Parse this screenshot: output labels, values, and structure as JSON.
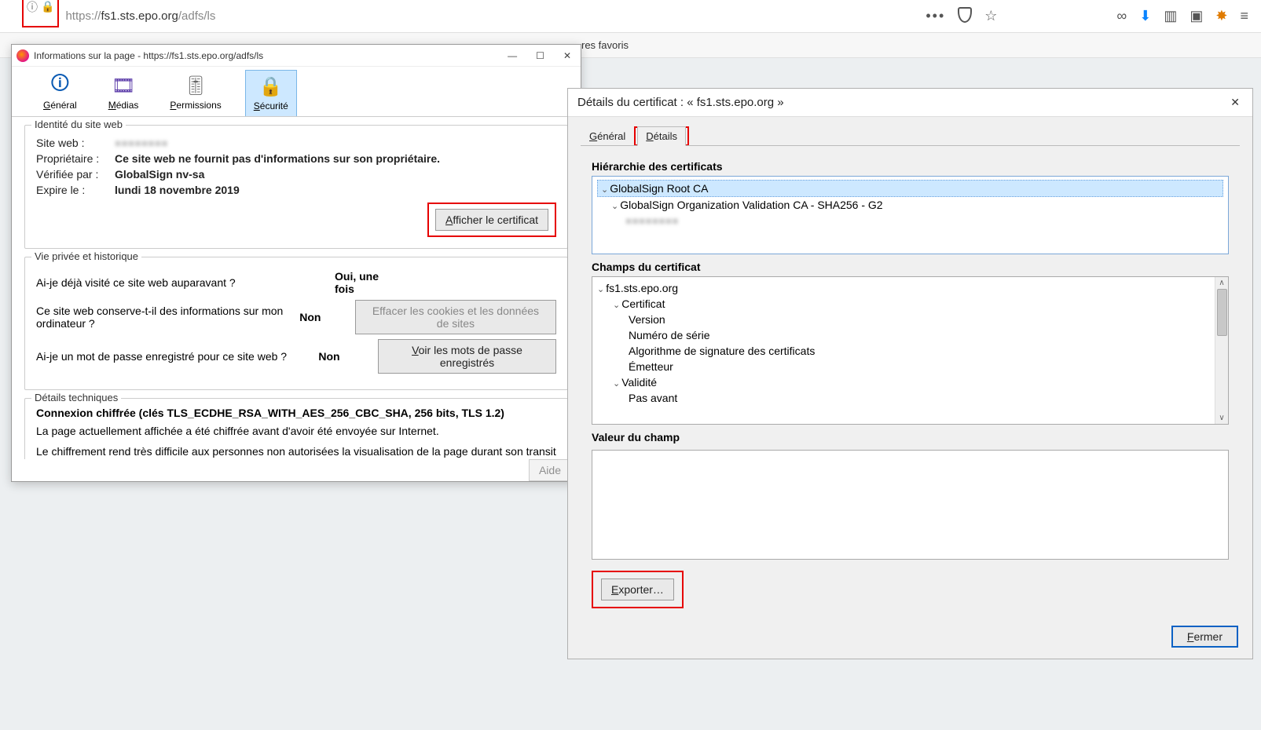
{
  "url": {
    "protocol": "https://",
    "host": "fs1.sts.epo.org",
    "path": "/adfs/ls"
  },
  "bookmarks_hint": "res favoris",
  "pageinfo": {
    "title_prefix": "Informations sur la page - ",
    "title_url": "https://fs1.sts.epo.org/adfs/ls",
    "tabs": {
      "general": "Général",
      "media": "Médias",
      "permissions": "Permissions",
      "security": "Sécurité"
    },
    "identity": {
      "legend": "Identité du site web",
      "site_label": "Site web :",
      "owner_label": "Propriétaire :",
      "owner_value": "Ce site web ne fournit pas d'informations sur son propriétaire.",
      "verified_label": "Vérifiée par :",
      "verified_value": "GlobalSign nv-sa",
      "expires_label": "Expire le :",
      "expires_value": "lundi 18 novembre 2019",
      "view_cert_btn": "fficher le certificat",
      "view_cert_btn_u": "A"
    },
    "privacy": {
      "legend": "Vie privée et historique",
      "q1": "Ai-je déjà visité ce site web auparavant ?",
      "a1": "Oui, une fois",
      "q2": "Ce site web conserve-t-il des informations sur mon ordinateur ?",
      "a2": "Non",
      "btn2": "Effacer les cookies et les données de sites",
      "q3": "Ai-je un mot de passe enregistré pour ce site web ?",
      "a3": "Non",
      "btn3_u": "V",
      "btn3": "oir les mots de passe enregistrés"
    },
    "tech": {
      "legend": "Détails techniques",
      "heading": "Connexion chiffrée (clés TLS_ECDHE_RSA_WITH_AES_256_CBC_SHA, 256 bits, TLS 1.2)",
      "p1": "La page actuellement affichée a été chiffrée avant d'avoir été envoyée sur Internet.",
      "p2": "Le chiffrement rend très difficile aux personnes non autorisées la visualisation de la page durant son transit entre ordinateurs. Il est donc très improbable que quelqu'un puisse lire cette page durant son transit sur le réseau."
    },
    "help_btn": "Aide"
  },
  "cert": {
    "title": "Détails du certificat : « fs1.sts.epo.org »",
    "tabs": {
      "general_u": "G",
      "general": "énéral",
      "details_u": "D",
      "details": "étails"
    },
    "hierarchy_label": "Hiérarchie des certificats",
    "hierarchy": {
      "root": "GlobalSign Root CA",
      "mid": "GlobalSign Organization Validation CA - SHA256 - G2"
    },
    "fields_label": "Champs du certificat",
    "fields": {
      "top": "fs1.sts.epo.org",
      "certificat": "Certificat",
      "version": "Version",
      "serial": "Numéro de série",
      "sigalg": "Algorithme de signature des certificats",
      "issuer": "Émetteur",
      "validity": "Validité",
      "notbefore": "Pas avant"
    },
    "value_label": "Valeur du champ",
    "export_btn_u": "E",
    "export_btn": "xporter…",
    "close_btn_u": "F",
    "close_btn": "ermer"
  }
}
